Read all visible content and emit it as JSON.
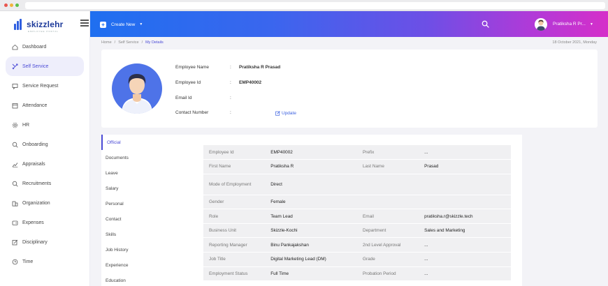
{
  "app": {
    "logo_text": "skizzlehr",
    "logo_tagline": "EMPLOYEE PORTAL"
  },
  "colors": {
    "accent": "#4b4bd6",
    "topbar_start": "#1f6ff0",
    "topbar_end": "#d52fc9",
    "avatar_bg": "#4e73e8"
  },
  "sidebar": {
    "items": [
      {
        "label": "Dashboard",
        "icon": "home-icon"
      },
      {
        "label": "Self Service",
        "icon": "self-service-icon"
      },
      {
        "label": "Service Request",
        "icon": "chat-icon"
      },
      {
        "label": "Attendance",
        "icon": "calendar-icon"
      },
      {
        "label": "HR",
        "icon": "gear-icon"
      },
      {
        "label": "Onboarding",
        "icon": "search-user-icon"
      },
      {
        "label": "Appraisals",
        "icon": "trend-icon"
      },
      {
        "label": "Recruitments",
        "icon": "search-icon"
      },
      {
        "label": "Organization",
        "icon": "building-icon"
      },
      {
        "label": "Expenses",
        "icon": "wallet-icon"
      },
      {
        "label": "Disciplinary",
        "icon": "edit-icon"
      },
      {
        "label": "Time",
        "icon": "clock-icon"
      }
    ]
  },
  "topbar": {
    "create_new": "Create New",
    "user_name": "Pratiksha R Pr..."
  },
  "breadcrumb": {
    "items": [
      "Home",
      "Self Service",
      "My Details"
    ],
    "separator": "/"
  },
  "date": "18 October 2021, Monday",
  "profile": {
    "rows": [
      {
        "label": "Employee Name",
        "value": "Pratiksha R Prasad"
      },
      {
        "label": "Employee Id",
        "value": "EMP40002"
      },
      {
        "label": "Email Id",
        "value": ""
      },
      {
        "label": "Contact Number",
        "value": ""
      }
    ],
    "update_label": "Update"
  },
  "tabs": [
    "Official",
    "Documents",
    "Leave",
    "Salary",
    "Personal",
    "Contact",
    "Skills",
    "Job History",
    "Experience",
    "Education"
  ],
  "details": [
    [
      "Employee Id",
      "EMP40002",
      "Prefix",
      "..."
    ],
    [
      "First Name",
      "Pratiksha R",
      "Last Name",
      "Prasad"
    ],
    [
      "Mode of Employment",
      "Direct",
      "",
      ""
    ],
    [
      "Gender",
      "Female",
      "",
      ""
    ],
    [
      "Role",
      "Team Lead",
      "Email",
      "pratiksha.r@skizzle.tech"
    ],
    [
      "Business Unit",
      "Skizzle-Kochi",
      "Department",
      "Sales and Marketing"
    ],
    [
      "Reporting Manager",
      "Binu Pankajakshan",
      "2nd Level Approval",
      "..."
    ],
    [
      "Job Title",
      "Digital Marketing Lead (DM)",
      "Grade",
      "..."
    ],
    [
      "Employment Status",
      "Full Time",
      "Probation Period",
      "..."
    ]
  ]
}
